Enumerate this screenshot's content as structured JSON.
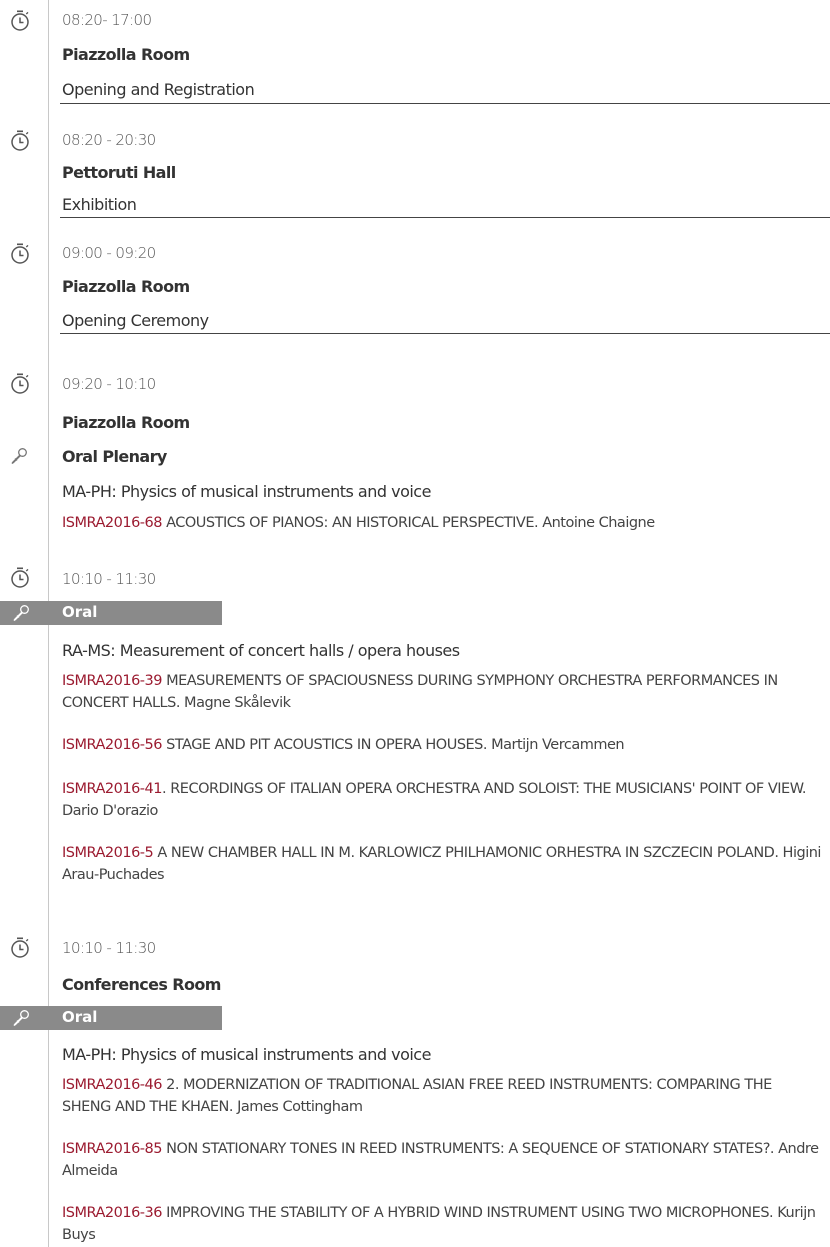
{
  "sessions": {
    "s1": {
      "time": "08:20- 17:00",
      "room": "Piazzolla Room",
      "title": "Opening and Registration"
    },
    "s2": {
      "time": "08:20 - 20:30",
      "room": "Pettoruti Hall",
      "title": "Exhibition"
    },
    "s3": {
      "time": "09:00 - 09:20",
      "room": "Piazzolla Room",
      "title": "Opening Ceremony"
    },
    "s4": {
      "time": "09:20 - 10:10",
      "room": "Piazzolla Room",
      "type": "Oral Plenary",
      "track": "MA-PH: Physics of musical instruments and voice",
      "presentations": [
        {
          "code": "ISMRA2016-68",
          "text": " ACOUSTICS OF PIANOS: AN HISTORICAL PERSPECTIVE. Antoine Chaigne"
        }
      ]
    },
    "s5": {
      "time": "10:10 - 11:30",
      "type": "Oral",
      "track": "RA-MS: Measurement of concert halls / opera houses",
      "presentations": [
        {
          "code": "ISMRA2016-39",
          "text": " MEASUREMENTS OF SPACIOUSNESS DURING SYMPHONY ORCHESTRA PERFORMANCES IN CONCERT HALLS. Magne Skålevik"
        },
        {
          "code": "ISMRA2016-56",
          "text": " STAGE AND PIT ACOUSTICS IN OPERA HOUSES. Martijn Vercammen"
        },
        {
          "code": "ISMRA2016-41",
          "text": ". RECORDINGS OF ITALIAN OPERA ORCHESTRA AND SOLOIST: THE MUSICIANS' POINT OF VIEW. Dario D'orazio"
        },
        {
          "code": "ISMRA2016-5",
          "text": " A NEW CHAMBER HALL IN M. KARLOWICZ PHILHAMONIC ORHESTRA IN SZCZECIN POLAND. Higini Arau-Puchades"
        }
      ]
    },
    "s6": {
      "time": "10:10 - 11:30",
      "room": "Conferences Room",
      "type": "Oral",
      "track": "MA-PH: Physics of musical instruments and voice",
      "presentations": [
        {
          "code": "ISMRA2016-46",
          "text": "  2. MODERNIZATION OF TRADITIONAL ASIAN FREE REED INSTRUMENTS: COMPARING THE SHENG AND THE KHAEN. James Cottingham"
        },
        {
          "code": "ISMRA2016-85",
          "text": " NON STATIONARY TONES IN REED INSTRUMENTS: A SEQUENCE OF STATIONARY STATES?. Andre Almeida"
        },
        {
          "code": "ISMRA2016-36",
          "text": " IMPROVING THE STABILITY OF A HYBRID WIND INSTRUMENT USING TWO MICROPHONES. Kurijn Buys"
        }
      ]
    }
  },
  "icons": {
    "clock": "stopwatch-icon",
    "mic": "microphone-icon"
  },
  "colors": {
    "code": "#9b1b30",
    "bar": "#8a8a8a",
    "rule": "#444444"
  }
}
